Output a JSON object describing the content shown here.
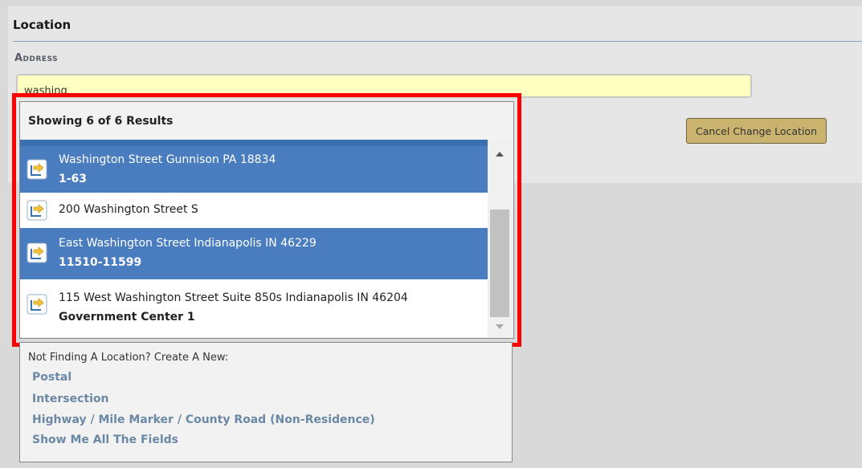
{
  "location": {
    "section_title": "Location",
    "address_label": "Address",
    "address_value": "washing",
    "cancel_button": "Cancel Change Location"
  },
  "results": {
    "header": "Showing 6 of 6 Results",
    "items": [
      {
        "line1": "Washington Street Gunnison PA 18834",
        "line2": "1-63",
        "selected": true
      },
      {
        "line1": "200 Washington Street S",
        "line2": "",
        "selected": false
      },
      {
        "line1": "East Washington Street Indianapolis IN 46229",
        "line2": "11510-11599",
        "selected": true
      },
      {
        "line1": "115 West Washington Street Suite 850s Indianapolis IN 46204",
        "line2": "Government Center 1",
        "selected": false
      }
    ],
    "icon": "location-arrow-icon",
    "colors": {
      "selected_bg": "#4a7dbf",
      "highlight_frame": "#ff0000"
    }
  },
  "not_found": {
    "title": "Not Finding A Location? Create A New:",
    "links": [
      "Postal",
      "Intersection",
      "Highway / Mile Marker / County Road (Non-Residence)",
      "Show Me All The Fields"
    ]
  }
}
